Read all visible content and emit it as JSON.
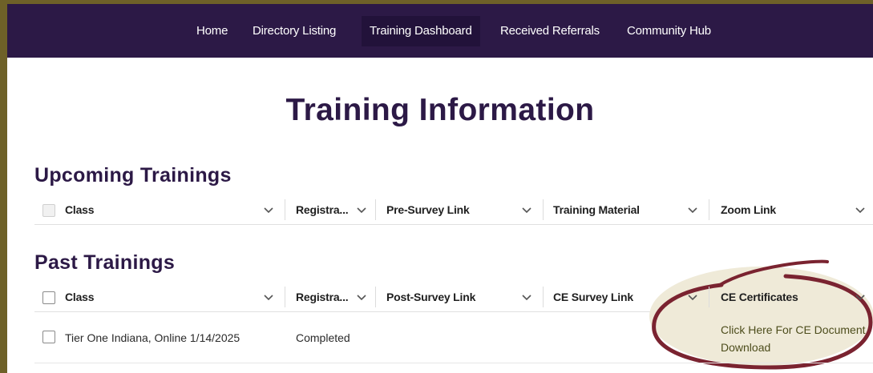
{
  "nav": {
    "items": [
      {
        "label": "Home"
      },
      {
        "label": "Directory Listing"
      },
      {
        "label": "Training Dashboard"
      },
      {
        "label": "Received Referrals"
      },
      {
        "label": "Community Hub"
      }
    ],
    "active": "Training Dashboard"
  },
  "page_title": "Training Information",
  "upcoming": {
    "title": "Upcoming Trainings",
    "columns": [
      "Class",
      "Registra...",
      "Pre-Survey Link",
      "Training Material",
      "Zoom Link"
    ]
  },
  "past": {
    "title": "Past Trainings",
    "columns": [
      "Class",
      "Registra...",
      "Post-Survey Link",
      "CE Survey Link",
      "CE Certificates"
    ],
    "rows": [
      {
        "class": "Tier One Indiana, Online 1/14/2025",
        "registration": "Completed",
        "post_survey_link": "",
        "ce_survey_link": "",
        "ce_certificates": "Click Here For CE Document Download"
      }
    ]
  },
  "colors": {
    "nav_bg": "#2c1946",
    "title": "#2c1946",
    "frame": "#6e6128",
    "highlight_fill": "#efead8",
    "highlight_stroke": "#7a2330"
  }
}
